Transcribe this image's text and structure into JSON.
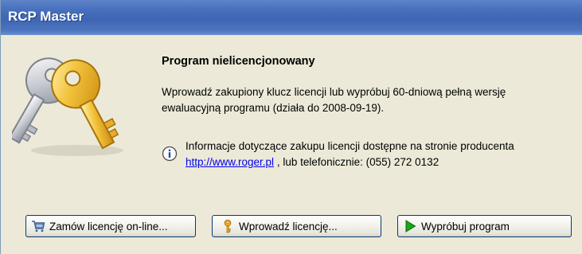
{
  "window": {
    "title": "RCP Master"
  },
  "dialog": {
    "heading": "Program nielicencjonowany",
    "message": "Wprowadź zakupiony klucz licencji lub wypróbuj 60-dniową pełną wersję ewaluacyjną programu (działa do 2008-09-19).",
    "info_text": "Informacje dotyczące zakupu licencji dostępne na stronie producenta",
    "info_link": "http://www.roger.pl",
    "info_suffix": " , lub telefonicznie: (055) 272 0132"
  },
  "buttons": {
    "order_label": "Zamów licencję on-line...",
    "enter_label": "Wprowadź licencję...",
    "try_label": "Wypróbuj program"
  },
  "icons": {
    "keys": "keys-icon",
    "info": "info-icon",
    "order": "shopping-cart-icon",
    "enter": "key-icon",
    "try": "play-icon"
  },
  "colors": {
    "titlebar": "#4a71bd",
    "link": "#0000ee",
    "play": "#1aa51a",
    "key_gold": "#f0b428"
  }
}
